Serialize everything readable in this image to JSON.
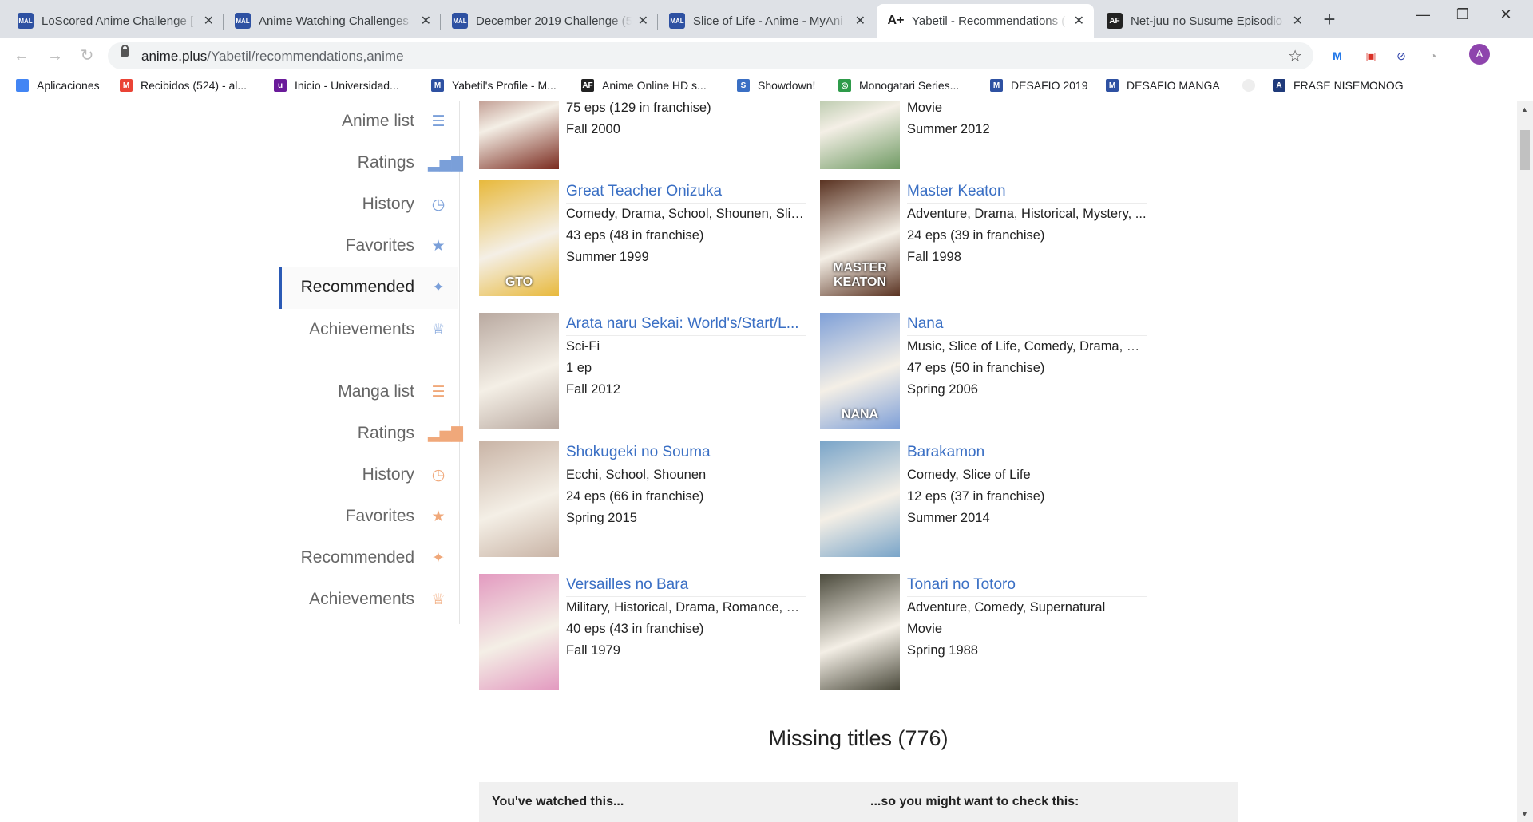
{
  "browser": {
    "tabs": [
      {
        "title": "LoScored Anime Challenge [",
        "icon": "mal"
      },
      {
        "title": "Anime Watching Challenges",
        "icon": "mal"
      },
      {
        "title": "December 2019 Challenge (5",
        "icon": "mal"
      },
      {
        "title": "Slice of Life - Anime - MyAni",
        "icon": "mal"
      },
      {
        "title": "Yabetil - Recommendations (",
        "icon": "animeplus"
      },
      {
        "title": "Net-juu no Susume Episodio",
        "icon": "af"
      }
    ],
    "url_host": "anime.plus",
    "url_path": "/Yabetil/recommendations,anime",
    "bookmarks": [
      {
        "label": "Aplicaciones",
        "color": "#4285f4"
      },
      {
        "label": "Recibidos (524) - al...",
        "color": "#ea4335"
      },
      {
        "label": "Inicio - Universidad...",
        "color": "#6a1b9a"
      },
      {
        "label": "Yabetil's Profile - M...",
        "color": "#2e51a2"
      },
      {
        "label": "Anime Online HD s...",
        "color": "#222222"
      },
      {
        "label": "Showdown!",
        "color": "#3a6fc4"
      },
      {
        "label": "Monogatari Series...",
        "color": "#2e9b4a"
      },
      {
        "label": "DESAFIO 2019",
        "color": "#2e51a2"
      },
      {
        "label": "DESAFIO MANGA",
        "color": "#2e51a2"
      },
      {
        "label": "FRASE NISEMONOG",
        "color": "#dddddd"
      }
    ]
  },
  "sidebar": {
    "anime": [
      {
        "label": "Anime list",
        "icon": "list-icon"
      },
      {
        "label": "Ratings",
        "icon": "chart-icon"
      },
      {
        "label": "History",
        "icon": "history-icon"
      },
      {
        "label": "Favorites",
        "icon": "star-icon"
      },
      {
        "label": "Recommended",
        "icon": "recommend-icon",
        "active": true
      },
      {
        "label": "Achievements",
        "icon": "trophy-icon"
      }
    ],
    "manga": [
      {
        "label": "Manga list",
        "icon": "list-icon"
      },
      {
        "label": "Ratings",
        "icon": "chart-icon"
      },
      {
        "label": "History",
        "icon": "history-icon"
      },
      {
        "label": "Favorites",
        "icon": "star-icon"
      },
      {
        "label": "Recommended",
        "icon": "recommend-icon"
      },
      {
        "label": "Achievements",
        "icon": "trophy-icon"
      }
    ]
  },
  "recommendations": [
    {
      "title": "",
      "genres": "",
      "episodes": "75 eps (129 in franchise)",
      "season": "Fall 2000",
      "poster_color": "#7a2a1e"
    },
    {
      "title": "",
      "genres": "",
      "episodes": "Movie",
      "season": "Summer 2012",
      "poster_color": "#6f9a63"
    },
    {
      "title": "Great Teacher Onizuka",
      "genres": "Comedy, Drama, School, Shounen, Slice...",
      "episodes": "43 eps (48 in franchise)",
      "season": "Summer 1999",
      "poster_color": "#e8b93c",
      "poster_text": "GTO"
    },
    {
      "title": "Master Keaton",
      "genres": "Adventure, Drama, Historical, Mystery, ...",
      "episodes": "24 eps (39 in franchise)",
      "season": "Fall 1998",
      "poster_color": "#5a3322",
      "poster_text": "MASTER KEATON"
    },
    {
      "title": "Arata naru Sekai: World's/Start/L...",
      "genres": "Sci-Fi",
      "episodes": "1 ep",
      "season": "Fall 2012",
      "poster_color": "#b9a9a0"
    },
    {
      "title": "Nana",
      "genres": "Music, Slice of Life, Comedy, Drama, Ro...",
      "episodes": "47 eps (50 in franchise)",
      "season": "Spring 2006",
      "poster_color": "#7fa0d8",
      "poster_text": "NANA"
    },
    {
      "title": "Shokugeki no Souma",
      "genres": "Ecchi, School, Shounen",
      "episodes": "24 eps (66 in franchise)",
      "season": "Spring 2015",
      "poster_color": "#c9b4a6"
    },
    {
      "title": "Barakamon",
      "genres": "Comedy, Slice of Life",
      "episodes": "12 eps (37 in franchise)",
      "season": "Summer 2014",
      "poster_color": "#7aa5c9"
    },
    {
      "title": "Versailles no Bara",
      "genres": "Military, Historical, Drama, Romance, S...",
      "episodes": "40 eps (43 in franchise)",
      "season": "Fall 1979",
      "poster_color": "#e39ac0"
    },
    {
      "title": "Tonari no Totoro",
      "genres": "Adventure, Comedy, Supernatural",
      "episodes": "Movie",
      "season": "Spring 1988",
      "poster_color": "#4b4a3c"
    }
  ],
  "missing": {
    "heading": "Missing titles (776)",
    "col_watched": "You've watched this...",
    "col_check": "...so you might want to check this:"
  }
}
